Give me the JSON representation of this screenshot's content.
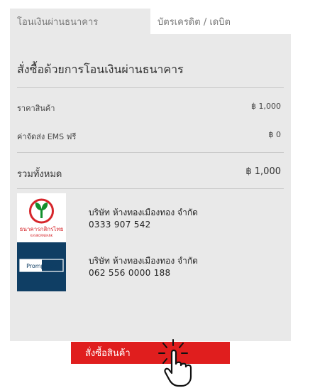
{
  "tabs": [
    {
      "label": "โอนเงินผ่านธนาคาร"
    },
    {
      "label": "บัตรเครดิต / เดบิต"
    }
  ],
  "panel": {
    "title": "สั่งซื้อด้วยการโอนเงินผ่านธนาคาร",
    "price_label": "ราคาสินค้า",
    "price_value": "฿ 1,000",
    "shipping_label": "ค่าจัดส่ง EMS ฟรี",
    "shipping_value": "฿ 0",
    "total_label": "รวมทั้งหมด",
    "total_value": "฿ 1,000"
  },
  "accounts": [
    {
      "bank_logo_text": "ธนาคารกสิกรไทย",
      "bank_logo_sub": "KASIKORNBANK",
      "name": "บริษัท ห้างทองเมืองทอง จำกัด",
      "number": "0333 907 542"
    },
    {
      "bank_logo_text": "PromptPay",
      "name": "บริษัท ห้างทองเมืองทอง จำกัด",
      "number": "062 556 0000 188"
    }
  ],
  "order_button": {
    "label": "สั่งซื้อสินค้า"
  },
  "colors": {
    "accent": "#e01e1e",
    "panel": "#e9e9e9",
    "kbank_green": "#138f2d",
    "promptpay_blue": "#0f3e64"
  },
  "icons": {
    "click_indicator": "hand-pointer-icon"
  }
}
